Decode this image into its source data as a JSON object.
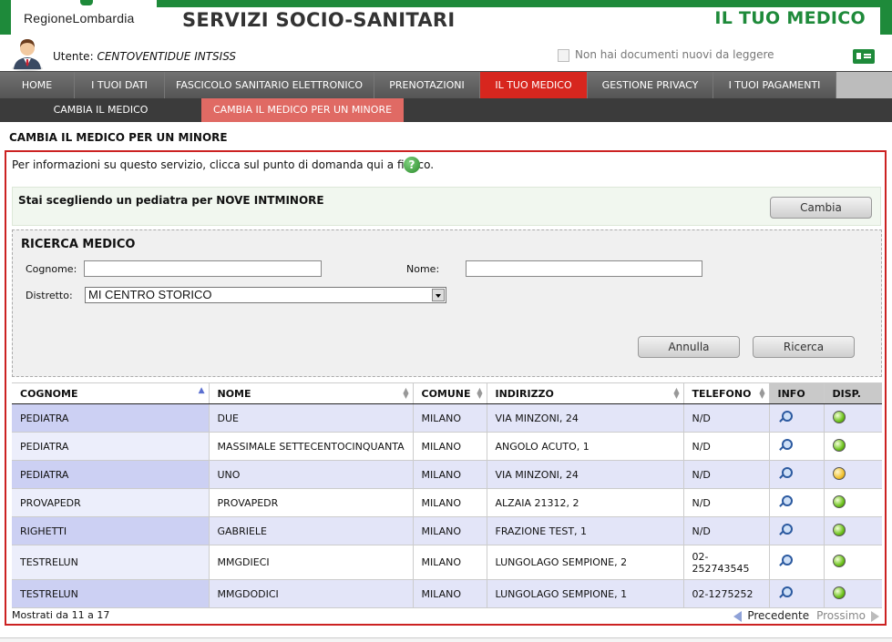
{
  "header": {
    "logo_text": "RegioneLombardia",
    "service_title": "SERVIZI SOCIO-SANITARI",
    "section_title": "IL TUO MEDICO",
    "brand_color": "#1e8a3a"
  },
  "user": {
    "label": "Utente:",
    "name": "CENTOVENTIDUE INTSISS",
    "documents_text": "Non hai documenti nuovi da leggere"
  },
  "nav": {
    "items": [
      {
        "label": "HOME"
      },
      {
        "label": "I TUOI DATI"
      },
      {
        "label": "FASCICOLO SANITARIO ELETTRONICO"
      },
      {
        "label": "PRENOTAZIONI"
      },
      {
        "label": "IL TUO MEDICO",
        "active": true
      },
      {
        "label": "GESTIONE PRIVACY"
      },
      {
        "label": "I TUOI PAGAMENTI"
      }
    ],
    "sub_items": [
      {
        "label": "CAMBIA IL MEDICO"
      },
      {
        "label": "CAMBIA IL MEDICO PER UN MINORE",
        "active": true
      }
    ],
    "active_color": "#d7261e"
  },
  "page": {
    "title": "CAMBIA IL MEDICO PER UN MINORE",
    "info_text": "Per informazioni su questo servizio, clicca sul punto di domanda qui a fianco.",
    "selection_text": "Stai scegliendo un pediatra per NOVE INTMINORE",
    "change_button": "Cambia"
  },
  "search": {
    "title": "RICERCA MEDICO",
    "cognome_label": "Cognome:",
    "cognome_value": "",
    "nome_label": "Nome:",
    "nome_value": "",
    "distretto_label": "Distretto:",
    "distretto_value": "MI CENTRO STORICO",
    "cancel_button": "Annulla",
    "search_button": "Ricerca"
  },
  "table": {
    "columns": [
      "COGNOME",
      "NOME",
      "COMUNE",
      "INDIRIZZO",
      "TELEFONO",
      "INFO",
      "DISP."
    ],
    "rows": [
      {
        "cognome": "PEDIATRA",
        "nome": "DUE",
        "comune": "MILANO",
        "indirizzo": "VIA MINZONI, 24",
        "telefono": "N/D",
        "disp": "available"
      },
      {
        "cognome": "PEDIATRA",
        "nome": "MASSIMALE SETTECENTOCINQUANTA",
        "comune": "MILANO",
        "indirizzo": "ANGOLO ACUTO, 1",
        "telefono": "N/D",
        "disp": "available"
      },
      {
        "cognome": "PEDIATRA",
        "nome": "UNO",
        "comune": "MILANO",
        "indirizzo": "VIA MINZONI, 24",
        "telefono": "N/D",
        "disp": "limited"
      },
      {
        "cognome": "PROVAPEDR",
        "nome": "PROVAPEDR",
        "comune": "MILANO",
        "indirizzo": "ALZAIA 21312, 2",
        "telefono": "N/D",
        "disp": "available"
      },
      {
        "cognome": "RIGHETTI",
        "nome": "GABRIELE",
        "comune": "MILANO",
        "indirizzo": "FRAZIONE TEST, 1",
        "telefono": "N/D",
        "disp": "available"
      },
      {
        "cognome": "TESTRELUN",
        "nome": "MMGDIECI",
        "comune": "MILANO",
        "indirizzo": "LUNGOLAGO SEMPIONE, 2",
        "telefono": "02-\n252743545",
        "disp": "available"
      },
      {
        "cognome": "TESTRELUN",
        "nome": "MMGDODICI",
        "comune": "MILANO",
        "indirizzo": "LUNGOLAGO SEMPIONE, 1",
        "telefono": "02-1275252",
        "disp": "available"
      }
    ],
    "status_colors": {
      "available": "#6cc21c",
      "limited": "#f1c232"
    }
  },
  "pagination": {
    "summary": "Mostrati da 11 a 17",
    "prev_label": "Precedente",
    "next_label": "Prossimo"
  }
}
